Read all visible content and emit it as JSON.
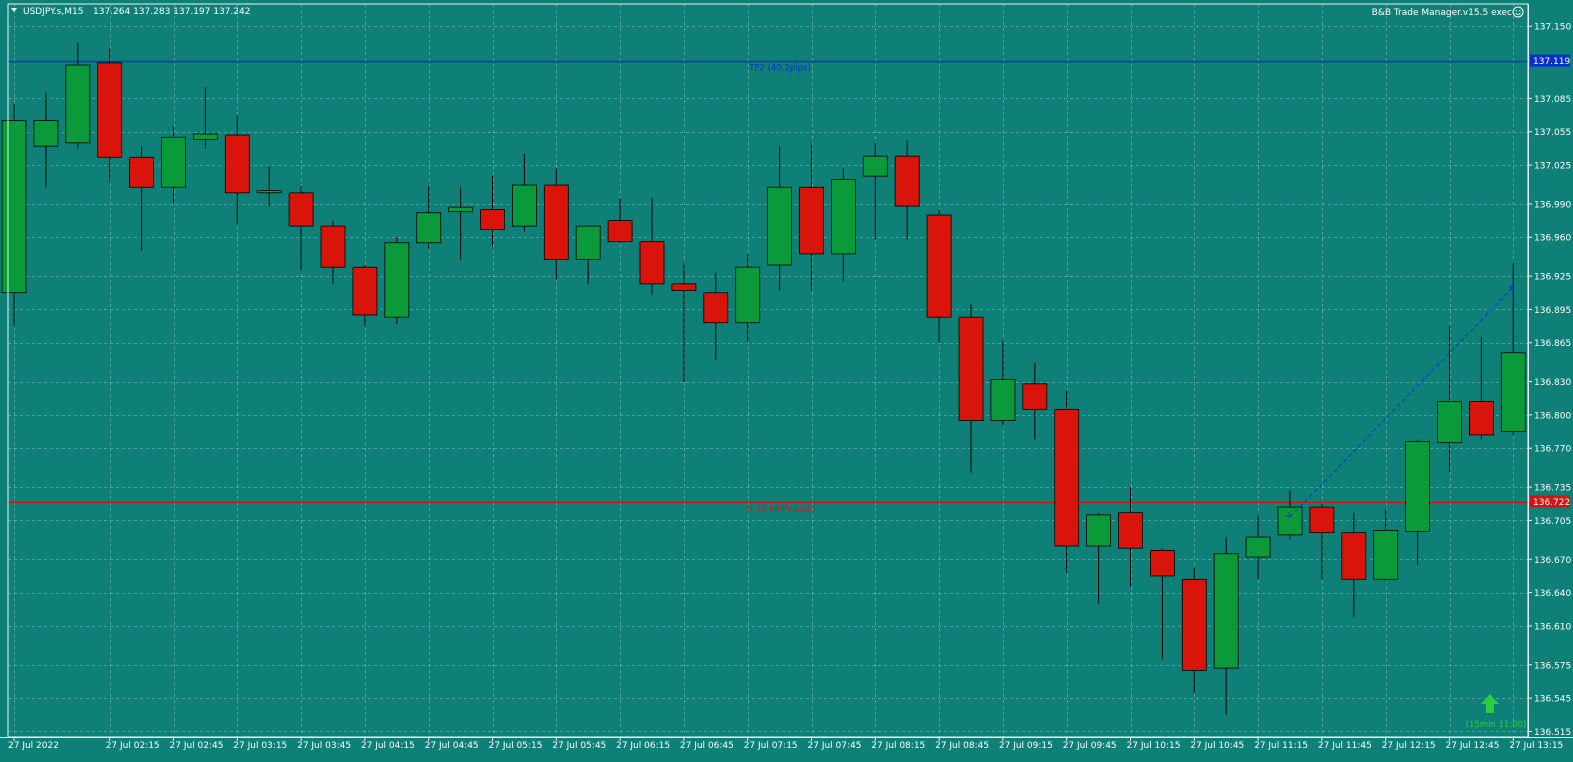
{
  "header": {
    "symbol_label": "USDJPY.s,M15",
    "ohlc": "137.264 137.283 137.197 137.242",
    "expert_label": "B&B Trade Manager.v15.5 exec",
    "expert_icon": "smiley-icon"
  },
  "colors": {
    "background": "#0f8077",
    "grid": "#5fb1a9",
    "bull": "#0a9a3a",
    "bear": "#d9140b",
    "wick": "#000000",
    "tp_line": "#0a2fd0",
    "sl_line": "#d01616",
    "signal_arrow": "#2ecc40"
  },
  "price_axis": {
    "min": 136.51,
    "max": 137.17,
    "ticks": [
      "137.150",
      "137.119",
      "137.085",
      "137.055",
      "137.025",
      "136.990",
      "136.960",
      "136.925",
      "136.895",
      "136.865",
      "136.830",
      "136.800",
      "136.770",
      "136.735",
      "136.722",
      "136.705",
      "136.670",
      "136.640",
      "136.610",
      "136.575",
      "136.545",
      "136.515"
    ]
  },
  "levels": {
    "tp": {
      "price": 137.119,
      "label": "TP2 (40.2pips)",
      "tag": "137.119"
    },
    "sl": {
      "price": 136.722,
      "label": "SL (0.6PIPs pips)",
      "tag": "136.722"
    }
  },
  "signal": {
    "label": "(15min 11:00)",
    "icon": "up-arrow-icon"
  },
  "trade_line": {
    "from": {
      "index": 40,
      "price": 136.708
    },
    "to": {
      "index": 47,
      "price": 136.915
    }
  },
  "time_axis": {
    "labels": [
      {
        "index": 0,
        "text": "27 Jul 2022"
      },
      {
        "index": 3,
        "text": "27 Jul 02:15"
      },
      {
        "index": 5,
        "text": "27 Jul 02:45"
      },
      {
        "index": 7,
        "text": "27 Jul 03:15"
      },
      {
        "index": 9,
        "text": "27 Jul 03:45"
      },
      {
        "index": 11,
        "text": "27 Jul 04:15"
      },
      {
        "index": 13,
        "text": "27 Jul 04:45"
      },
      {
        "index": 15,
        "text": "27 Jul 05:15"
      },
      {
        "index": 17,
        "text": "27 Jul 05:45"
      },
      {
        "index": 19,
        "text": "27 Jul 06:15"
      },
      {
        "index": 21,
        "text": "27 Jul 06:45"
      },
      {
        "index": 23,
        "text": "27 Jul 07:15"
      },
      {
        "index": 25,
        "text": "27 Jul 07:45"
      },
      {
        "index": 27,
        "text": "27 Jul 08:15"
      },
      {
        "index": 29,
        "text": "27 Jul 08:45"
      },
      {
        "index": 31,
        "text": "27 Jul 09:15"
      },
      {
        "index": 33,
        "text": "27 Jul 09:45"
      },
      {
        "index": 35,
        "text": "27 Jul 10:15"
      },
      {
        "index": 37,
        "text": "27 Jul 10:45"
      },
      {
        "index": 39,
        "text": "27 Jul 11:15"
      },
      {
        "index": 41,
        "text": "27 Jul 11:45"
      },
      {
        "index": 43,
        "text": "27 Jul 12:15"
      },
      {
        "index": 45,
        "text": "27 Jul 12:45"
      },
      {
        "index": 47,
        "text": "27 Jul 13:15"
      }
    ]
  },
  "chart_data": {
    "type": "candlestick",
    "symbol": "USDJPY.s",
    "timeframe": "M15",
    "ylim": [
      136.51,
      137.17
    ],
    "candles": [
      {
        "o": 136.91,
        "h": 137.08,
        "l": 136.88,
        "c": 137.065
      },
      {
        "o": 137.042,
        "h": 137.09,
        "l": 137.005,
        "c": 137.065
      },
      {
        "o": 137.045,
        "h": 137.135,
        "l": 137.04,
        "c": 137.115
      },
      {
        "o": 137.117,
        "h": 137.13,
        "l": 137.01,
        "c": 137.032
      },
      {
        "o": 137.032,
        "h": 137.042,
        "l": 136.948,
        "c": 137.005
      },
      {
        "o": 137.005,
        "h": 137.06,
        "l": 136.99,
        "c": 137.05
      },
      {
        "o": 137.048,
        "h": 137.095,
        "l": 137.04,
        "c": 137.053
      },
      {
        "o": 137.052,
        "h": 137.07,
        "l": 136.972,
        "c": 137.0
      },
      {
        "o": 137.0,
        "h": 137.024,
        "l": 136.988,
        "c": 137.002
      },
      {
        "o": 137.0,
        "h": 137.006,
        "l": 136.93,
        "c": 136.97
      },
      {
        "o": 136.97,
        "h": 136.975,
        "l": 136.918,
        "c": 136.933
      },
      {
        "o": 136.933,
        "h": 136.935,
        "l": 136.88,
        "c": 136.89
      },
      {
        "o": 136.888,
        "h": 136.96,
        "l": 136.882,
        "c": 136.955
      },
      {
        "o": 136.955,
        "h": 137.007,
        "l": 136.95,
        "c": 136.982
      },
      {
        "o": 136.983,
        "h": 137.005,
        "l": 136.94,
        "c": 136.987
      },
      {
        "o": 136.985,
        "h": 137.015,
        "l": 136.952,
        "c": 136.967
      },
      {
        "o": 136.97,
        "h": 137.035,
        "l": 136.965,
        "c": 137.007
      },
      {
        "o": 137.007,
        "h": 137.022,
        "l": 136.922,
        "c": 136.94
      },
      {
        "o": 136.94,
        "h": 136.965,
        "l": 136.918,
        "c": 136.97
      },
      {
        "o": 136.975,
        "h": 136.995,
        "l": 136.955,
        "c": 136.956
      },
      {
        "o": 136.956,
        "h": 136.995,
        "l": 136.908,
        "c": 136.918
      },
      {
        "o": 136.918,
        "h": 136.937,
        "l": 136.83,
        "c": 136.912
      },
      {
        "o": 136.91,
        "h": 136.928,
        "l": 136.85,
        "c": 136.883
      },
      {
        "o": 136.883,
        "h": 136.945,
        "l": 136.865,
        "c": 136.933
      },
      {
        "o": 136.935,
        "h": 137.042,
        "l": 136.912,
        "c": 137.005
      },
      {
        "o": 137.005,
        "h": 137.045,
        "l": 136.912,
        "c": 136.945
      },
      {
        "o": 136.945,
        "h": 137.022,
        "l": 136.92,
        "c": 137.012
      },
      {
        "o": 137.015,
        "h": 137.045,
        "l": 136.958,
        "c": 137.033
      },
      {
        "o": 137.033,
        "h": 137.047,
        "l": 136.958,
        "c": 136.988
      },
      {
        "o": 136.98,
        "h": 136.985,
        "l": 136.865,
        "c": 136.888
      },
      {
        "o": 136.888,
        "h": 136.9,
        "l": 136.748,
        "c": 136.795
      },
      {
        "o": 136.795,
        "h": 136.867,
        "l": 136.79,
        "c": 136.832
      },
      {
        "o": 136.828,
        "h": 136.847,
        "l": 136.778,
        "c": 136.805
      },
      {
        "o": 136.805,
        "h": 136.822,
        "l": 136.658,
        "c": 136.682
      },
      {
        "o": 136.682,
        "h": 136.712,
        "l": 136.63,
        "c": 136.71
      },
      {
        "o": 136.712,
        "h": 136.735,
        "l": 136.645,
        "c": 136.68
      },
      {
        "o": 136.678,
        "h": 136.68,
        "l": 136.58,
        "c": 136.655
      },
      {
        "o": 136.652,
        "h": 136.662,
        "l": 136.55,
        "c": 136.57
      },
      {
        "o": 136.572,
        "h": 136.69,
        "l": 136.53,
        "c": 136.675
      },
      {
        "o": 136.672,
        "h": 136.71,
        "l": 136.652,
        "c": 136.69
      },
      {
        "o": 136.692,
        "h": 136.732,
        "l": 136.688,
        "c": 136.717
      },
      {
        "o": 136.717,
        "h": 136.72,
        "l": 136.652,
        "c": 136.694
      },
      {
        "o": 136.694,
        "h": 136.712,
        "l": 136.618,
        "c": 136.652
      },
      {
        "o": 136.652,
        "h": 136.716,
        "l": 136.65,
        "c": 136.696
      },
      {
        "o": 136.695,
        "h": 136.778,
        "l": 136.665,
        "c": 136.776
      },
      {
        "o": 136.775,
        "h": 136.88,
        "l": 136.748,
        "c": 136.812
      },
      {
        "o": 136.812,
        "h": 136.87,
        "l": 136.778,
        "c": 136.782
      },
      {
        "o": 136.785,
        "h": 136.937,
        "l": 136.782,
        "c": 136.856
      }
    ]
  }
}
